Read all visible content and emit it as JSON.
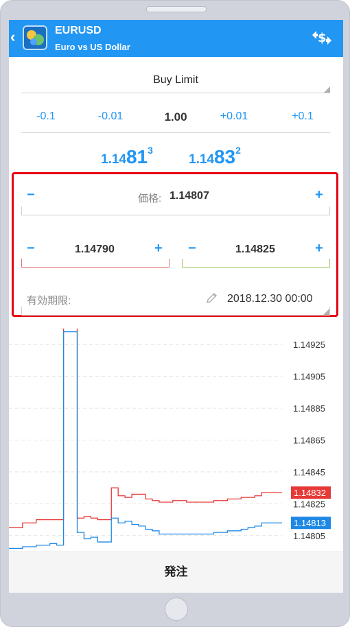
{
  "header": {
    "symbol": "EURUSD",
    "description": "Euro vs US Dollar",
    "accent": "#2196f3"
  },
  "order_type": {
    "value": "Buy Limit"
  },
  "volume": {
    "steps": [
      "-0.1",
      "-0.01",
      "1.00",
      "+0.01",
      "+0.1"
    ]
  },
  "quotes": {
    "bid": {
      "prefix": "1.14",
      "big": "81",
      "sup": "3"
    },
    "ask": {
      "prefix": "1.14",
      "big": "83",
      "sup": "2"
    }
  },
  "pending": {
    "price_label": "価格:",
    "price_value": "1.14807",
    "sl_value": "1.14790",
    "tp_value": "1.14825",
    "sl_color": "#e57373",
    "tp_color": "#9ccc65",
    "expiry_label": "有効期限:",
    "expiry_value": "2018.12.30 00:00"
  },
  "chart_data": {
    "type": "line",
    "ylim": [
      1.14795,
      1.14935
    ],
    "y_ticks": [
      "1.14925",
      "1.14905",
      "1.14885",
      "1.14865",
      "1.14845",
      "1.14825",
      "1.14805"
    ],
    "y_tick_values": [
      1.14925,
      1.14905,
      1.14885,
      1.14865,
      1.14845,
      1.14825,
      1.14805
    ],
    "series": [
      {
        "color": "#e53935",
        "values": [
          1.1481,
          1.1481,
          1.14813,
          1.14813,
          1.14815,
          1.14815,
          1.14815,
          1.14815,
          1.1494,
          1.1494,
          1.14816,
          1.14817,
          1.14816,
          1.14815,
          1.14815,
          1.14835,
          1.1483,
          1.14829,
          1.14831,
          1.14831,
          1.14828,
          1.14827,
          1.14826,
          1.14826,
          1.14827,
          1.14827,
          1.14826,
          1.14826,
          1.14826,
          1.14826,
          1.14827,
          1.14827,
          1.14828,
          1.14828,
          1.14829,
          1.14829,
          1.1483,
          1.14832,
          1.14832,
          1.14832,
          1.14832
        ]
      },
      {
        "color": "#1e88e5",
        "values": [
          1.14797,
          1.14797,
          1.14798,
          1.14798,
          1.14799,
          1.14799,
          1.148,
          1.14799,
          1.14933,
          1.14933,
          1.14807,
          1.14803,
          1.14804,
          1.14801,
          1.14801,
          1.14816,
          1.14813,
          1.14814,
          1.14812,
          1.14811,
          1.14809,
          1.14808,
          1.14806,
          1.14806,
          1.14806,
          1.14806,
          1.14806,
          1.14806,
          1.14806,
          1.14806,
          1.14807,
          1.14807,
          1.14808,
          1.14808,
          1.14809,
          1.1481,
          1.14811,
          1.14813,
          1.14813,
          1.14813,
          1.14813
        ]
      }
    ],
    "labels": [
      {
        "text": "1.14832",
        "color": "#e53935",
        "value": 1.14832
      },
      {
        "text": "1.14813",
        "color": "#1e88e5",
        "value": 1.14813
      }
    ]
  },
  "footer": {
    "order_button": "発注"
  }
}
